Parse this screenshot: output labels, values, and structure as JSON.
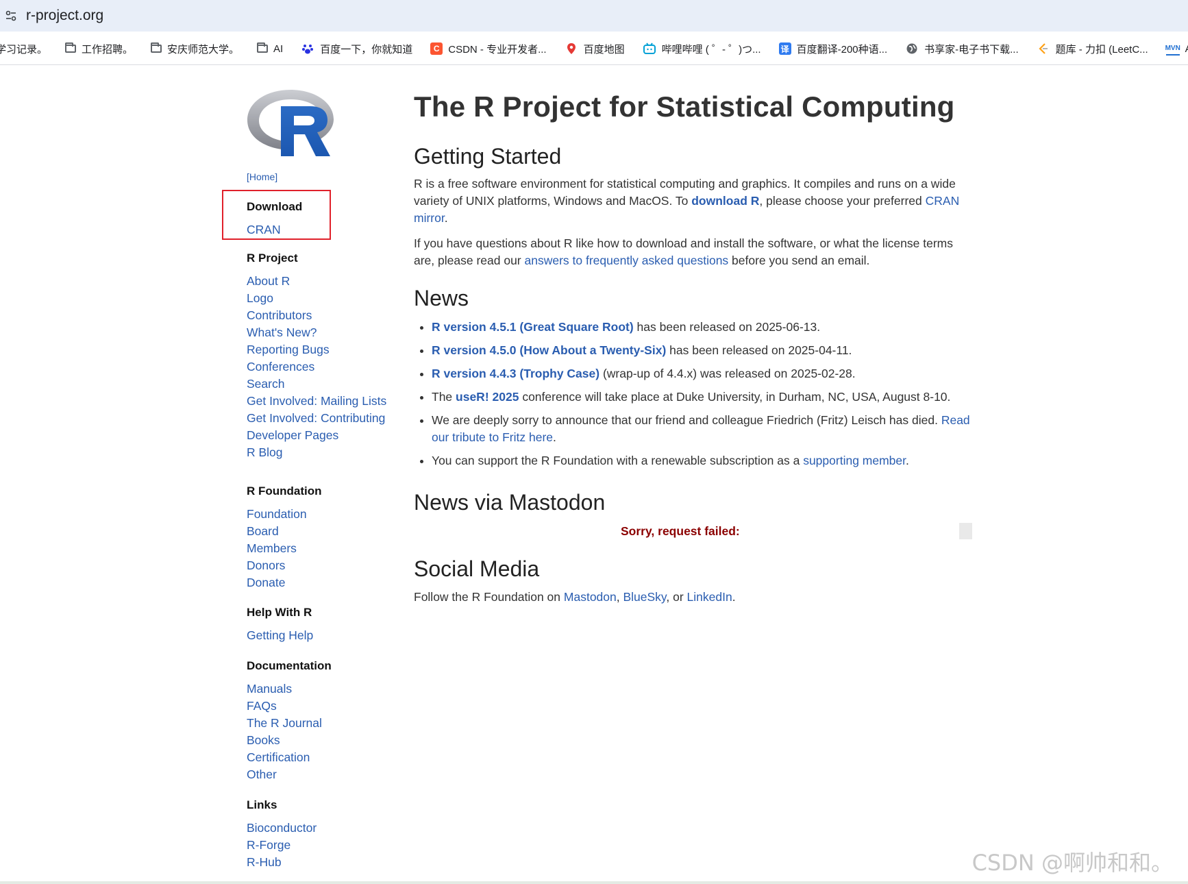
{
  "browser": {
    "url": "r-project.org",
    "bookmarks": [
      {
        "label": "学习记录。",
        "icon": "folder-icon"
      },
      {
        "label": "工作招聘。",
        "icon": "folder-icon"
      },
      {
        "label": "安庆师范大学。",
        "icon": "folder-icon"
      },
      {
        "label": "AI",
        "icon": "folder-icon"
      },
      {
        "label": "百度一下，你就知道",
        "icon": "baidu-icon"
      },
      {
        "label": "CSDN - 专业开发者...",
        "icon": "csdn-icon"
      },
      {
        "label": "百度地图",
        "icon": "map-pin-icon"
      },
      {
        "label": "哔哩哔哩 ( ゜- ゜)つ...",
        "icon": "bilibili-icon"
      },
      {
        "label": "百度翻译-200种语...",
        "icon": "translate-icon"
      },
      {
        "label": "书享家-电子书下载...",
        "icon": "globe-icon"
      },
      {
        "label": "题库 - 力扣 (LeetC...",
        "icon": "leetcode-icon"
      },
      {
        "label": "At",
        "icon": "mvn-icon"
      }
    ]
  },
  "sidebar": {
    "home": "[Home]",
    "sections": [
      {
        "heading": "Download",
        "links": [
          "CRAN"
        ]
      },
      {
        "heading": "R Project",
        "links": [
          "About R",
          "Logo",
          "Contributors",
          "What's New?",
          "Reporting Bugs",
          "Conferences",
          "Search",
          "Get Involved: Mailing Lists",
          "Get Involved: Contributing",
          "Developer Pages",
          "R Blog"
        ]
      },
      {
        "heading": "R Foundation",
        "links": [
          "Foundation",
          "Board",
          "Members",
          "Donors",
          "Donate"
        ]
      },
      {
        "heading": "Help With R",
        "links": [
          "Getting Help"
        ]
      },
      {
        "heading": "Documentation",
        "links": [
          "Manuals",
          "FAQs",
          "The R Journal",
          "Books",
          "Certification",
          "Other"
        ]
      },
      {
        "heading": "Links",
        "links": [
          "Bioconductor",
          "R-Forge",
          "R-Hub"
        ]
      }
    ]
  },
  "main": {
    "title": "The R Project for Statistical Computing",
    "getting_started": {
      "heading": "Getting Started",
      "p1_a": "R is a free software environment for statistical computing and graphics. It compiles and runs on a wide variety of UNIX platforms, Windows and MacOS. To ",
      "p1_link1": "download R",
      "p1_b": ", please choose your preferred ",
      "p1_link2": "CRAN mirror",
      "p1_c": ".",
      "p2_a": "If you have questions about R like how to download and install the software, or what the license terms are, please read our ",
      "p2_link": "answers to frequently asked questions",
      "p2_b": " before you send an email."
    },
    "news": {
      "heading": "News",
      "items": [
        {
          "pre": "",
          "link": "R version 4.5.1 (Great Square Root)",
          "post": " has been released on 2025-06-13."
        },
        {
          "pre": "",
          "link": "R version 4.5.0 (How About a Twenty-Six)",
          "post": " has been released on 2025-04-11."
        },
        {
          "pre": "",
          "link": "R version 4.4.3 (Trophy Case)",
          "post": " (wrap-up of 4.4.x) was released on 2025-02-28."
        },
        {
          "pre": "The ",
          "link": "useR! 2025",
          "post": " conference will take place at Duke University, in Durham, NC, USA, August 8-10."
        },
        {
          "pre": "We are deeply sorry to announce that our friend and colleague Friedrich (Fritz) Leisch has died. ",
          "link": "Read our tribute to Fritz here",
          "post": "."
        },
        {
          "pre": "You can support the R Foundation with a renewable subscription as a ",
          "link": "supporting member",
          "post": "."
        }
      ]
    },
    "mastodon": {
      "heading": "News via Mastodon",
      "error": "Sorry, request failed:"
    },
    "social": {
      "heading": "Social Media",
      "pre": "Follow the R Foundation on ",
      "link1": "Mastodon",
      "sep1": ", ",
      "link2": "BlueSky",
      "sep2": ", or ",
      "link3": "LinkedIn",
      "post": "."
    }
  },
  "watermark": "CSDN @啊帅和和。",
  "colors": {
    "link": "#2a5db0",
    "highlight_box": "#e0202a",
    "error": "#8b0000"
  }
}
